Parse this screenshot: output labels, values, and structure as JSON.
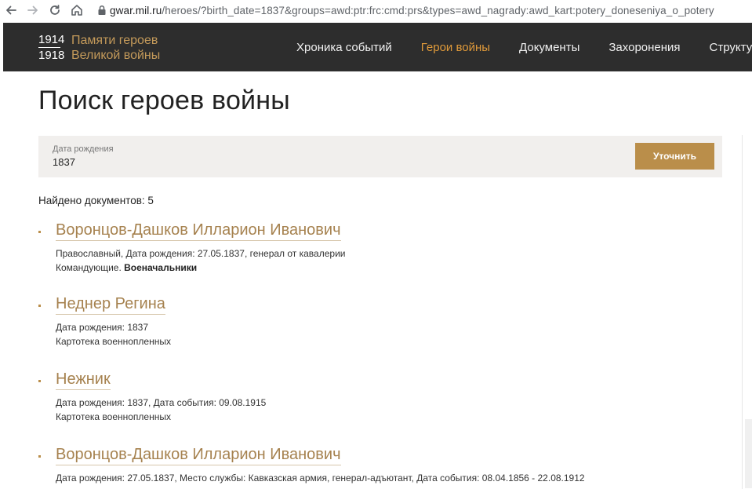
{
  "browser": {
    "url_host": "gwar.mil.ru",
    "url_rest": "/heroes/?birth_date=1837&groups=awd:ptr:frc:cmd:prs&types=awd_nagrady:awd_kart:potery_doneseniya_o_potery",
    "icons": [
      "back-arrow-icon",
      "forward-arrow-icon",
      "reload-icon",
      "home-icon",
      "lock-icon"
    ]
  },
  "site": {
    "logo": {
      "year_start": "1914",
      "year_end": "1918",
      "line1": "Памяти героев",
      "line2": "Великой войны"
    },
    "nav": [
      {
        "label": "Хроника событий",
        "active": false
      },
      {
        "label": "Герои войны",
        "active": true
      },
      {
        "label": "Документы",
        "active": false
      },
      {
        "label": "Захоронения",
        "active": false
      },
      {
        "label": "Структур",
        "active": false
      }
    ],
    "header_bg": "#2d2d2d",
    "accent": "#ba8e4a",
    "active_nav_color": "#e09a3a"
  },
  "page": {
    "title": "Поиск героев войны",
    "filter": {
      "label": "Дата рождения",
      "value": "1837",
      "button": "Уточнить"
    },
    "found_text": "Найдено документов: 5",
    "results": [
      {
        "title": "Воронцов-Дашков Илларион Иванович",
        "line1": "Православный, Дата рождения: 27.05.1837, генерал от кавалерии",
        "line2_prefix": "Командующие. ",
        "line2_bold": "Военачальники"
      },
      {
        "title": "Неднер Регина",
        "line1": "Дата рождения: 1837",
        "line2": "Картотека военнопленных"
      },
      {
        "title": "Нежник",
        "line1": "Дата рождения: 1837, Дата события: 09.08.1915",
        "line2": "Картотека военнопленных"
      },
      {
        "title": "Воронцов-Дашков Илларион Иванович",
        "line1": "Дата рождения: 27.05.1837, Место службы: Кавказская армия, генерал-адъютант, Дата события: 08.04.1856 - 22.08.1912"
      }
    ]
  }
}
